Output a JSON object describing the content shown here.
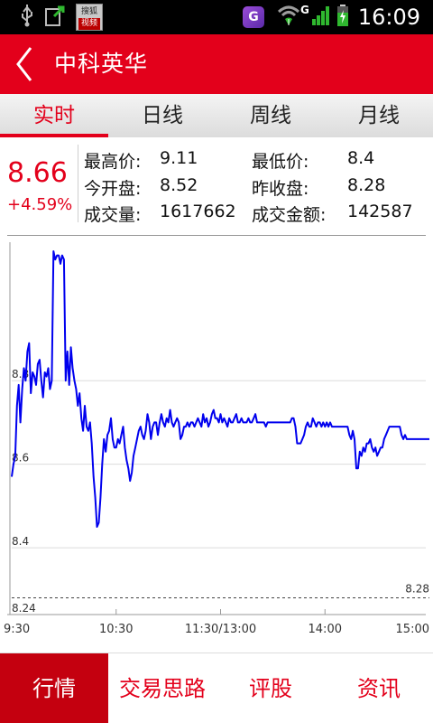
{
  "status_bar": {
    "time": "16:09",
    "network": "G",
    "badge_top": "搜狐",
    "badge_bottom": "视频",
    "app_icon_letter": "G"
  },
  "header": {
    "title": "中科英华"
  },
  "tabs": [
    {
      "label": "实时",
      "active": true
    },
    {
      "label": "日线",
      "active": false
    },
    {
      "label": "周线",
      "active": false
    },
    {
      "label": "月线",
      "active": false
    }
  ],
  "quote": {
    "price": "8.66",
    "change_pct": "+4.59%",
    "high_label": "最高价:",
    "high_value": "9.11",
    "low_label": "最低价:",
    "low_value": "8.4",
    "open_label": "今开盘:",
    "open_value": "8.52",
    "prev_close_label": "昨收盘:",
    "prev_close_value": "8.28",
    "volume_label": "成交量:",
    "volume_value": "1617662",
    "amount_label": "成交金额:",
    "amount_value": "142587"
  },
  "bottom_tabs": [
    {
      "label": "行情",
      "active": true
    },
    {
      "label": "交易思路",
      "active": false
    },
    {
      "label": "评股",
      "active": false
    },
    {
      "label": "资讯",
      "active": false
    }
  ],
  "colors": {
    "brand_red": "#e3001b",
    "line_blue": "#0000ee",
    "grid": "#dcdcdc"
  },
  "chart_data": {
    "type": "line",
    "y_tick_labels": [
      "8.8",
      "8.6",
      "8.4",
      "8.24"
    ],
    "y_ticks": [
      8.8,
      8.6,
      8.4,
      8.24
    ],
    "x_tick_labels": [
      "9:30",
      "10:30",
      "11:30/13:00",
      "14:00",
      "15:00"
    ],
    "x_ticks": [
      0,
      60,
      120,
      180,
      240
    ],
    "ylim": [
      8.24,
      9.11
    ],
    "xlim": [
      0,
      240
    ],
    "prev_close": 8.28,
    "prev_close_label": "8.28",
    "grid": true,
    "series": [
      {
        "color": "#0000ee",
        "points": [
          [
            0,
            8.57
          ],
          [
            1,
            8.6
          ],
          [
            2,
            8.62
          ],
          [
            3,
            8.74
          ],
          [
            4,
            8.79
          ],
          [
            5,
            8.7
          ],
          [
            6,
            8.78
          ],
          [
            7,
            8.83
          ],
          [
            8,
            8.8
          ],
          [
            9,
            8.87
          ],
          [
            10,
            8.89
          ],
          [
            11,
            8.77
          ],
          [
            12,
            8.82
          ],
          [
            13,
            8.81
          ],
          [
            14,
            8.79
          ],
          [
            15,
            8.84
          ],
          [
            16,
            8.85
          ],
          [
            17,
            8.8
          ],
          [
            18,
            8.76
          ],
          [
            19,
            8.82
          ],
          [
            20,
            8.81
          ],
          [
            21,
            8.83
          ],
          [
            22,
            8.78
          ],
          [
            23,
            8.8
          ],
          [
            24,
            9.11
          ],
          [
            25,
            9.09
          ],
          [
            26,
            9.1
          ],
          [
            27,
            9.1
          ],
          [
            28,
            9.08
          ],
          [
            29,
            9.1
          ],
          [
            30,
            9.09
          ],
          [
            31,
            8.8
          ],
          [
            32,
            8.87
          ],
          [
            33,
            8.79
          ],
          [
            34,
            8.88
          ],
          [
            35,
            8.83
          ],
          [
            36,
            8.8
          ],
          [
            37,
            8.78
          ],
          [
            38,
            8.74
          ],
          [
            39,
            8.77
          ],
          [
            40,
            8.71
          ],
          [
            41,
            8.68
          ],
          [
            42,
            8.74
          ],
          [
            43,
            8.69
          ],
          [
            44,
            8.68
          ],
          [
            45,
            8.7
          ],
          [
            46,
            8.65
          ],
          [
            47,
            8.57
          ],
          [
            48,
            8.52
          ],
          [
            49,
            8.45
          ],
          [
            50,
            8.46
          ],
          [
            51,
            8.52
          ],
          [
            52,
            8.6
          ],
          [
            53,
            8.66
          ],
          [
            54,
            8.63
          ],
          [
            55,
            8.67
          ],
          [
            56,
            8.68
          ],
          [
            57,
            8.71
          ],
          [
            58,
            8.66
          ],
          [
            59,
            8.64
          ],
          [
            60,
            8.64
          ],
          [
            61,
            8.66
          ],
          [
            62,
            8.65
          ],
          [
            63,
            8.67
          ],
          [
            64,
            8.69
          ],
          [
            65,
            8.64
          ],
          [
            66,
            8.61
          ],
          [
            67,
            8.59
          ],
          [
            68,
            8.56
          ],
          [
            69,
            8.58
          ],
          [
            70,
            8.62
          ],
          [
            71,
            8.64
          ],
          [
            72,
            8.66
          ],
          [
            73,
            8.68
          ],
          [
            74,
            8.69
          ],
          [
            75,
            8.67
          ],
          [
            76,
            8.66
          ],
          [
            77,
            8.68
          ],
          [
            78,
            8.72
          ],
          [
            79,
            8.7
          ],
          [
            80,
            8.66
          ],
          [
            81,
            8.69
          ],
          [
            82,
            8.7
          ],
          [
            83,
            8.7
          ],
          [
            84,
            8.67
          ],
          [
            85,
            8.7
          ],
          [
            86,
            8.72
          ],
          [
            87,
            8.7
          ],
          [
            88,
            8.69
          ],
          [
            89,
            8.71
          ],
          [
            90,
            8.7
          ],
          [
            91,
            8.73
          ],
          [
            92,
            8.7
          ],
          [
            93,
            8.69
          ],
          [
            94,
            8.7
          ],
          [
            95,
            8.71
          ],
          [
            96,
            8.7
          ],
          [
            97,
            8.66
          ],
          [
            98,
            8.67
          ],
          [
            99,
            8.69
          ],
          [
            100,
            8.69
          ],
          [
            101,
            8.7
          ],
          [
            102,
            8.69
          ],
          [
            103,
            8.7
          ],
          [
            104,
            8.7
          ],
          [
            105,
            8.69
          ],
          [
            106,
            8.7
          ],
          [
            107,
            8.71
          ],
          [
            108,
            8.7
          ],
          [
            109,
            8.69
          ],
          [
            110,
            8.72
          ],
          [
            111,
            8.7
          ],
          [
            112,
            8.71
          ],
          [
            113,
            8.69
          ],
          [
            114,
            8.7
          ],
          [
            115,
            8.72
          ],
          [
            116,
            8.73
          ],
          [
            117,
            8.71
          ],
          [
            118,
            8.71
          ],
          [
            119,
            8.7
          ],
          [
            120,
            8.72
          ],
          [
            121,
            8.7
          ],
          [
            122,
            8.71
          ],
          [
            123,
            8.7
          ],
          [
            124,
            8.69
          ],
          [
            125,
            8.71
          ],
          [
            126,
            8.7
          ],
          [
            127,
            8.7
          ],
          [
            128,
            8.71
          ],
          [
            129,
            8.72
          ],
          [
            130,
            8.7
          ],
          [
            131,
            8.7
          ],
          [
            132,
            8.71
          ],
          [
            133,
            8.7
          ],
          [
            134,
            8.7
          ],
          [
            135,
            8.7
          ],
          [
            136,
            8.71
          ],
          [
            137,
            8.7
          ],
          [
            138,
            8.7
          ],
          [
            139,
            8.71
          ],
          [
            140,
            8.72
          ],
          [
            141,
            8.7
          ],
          [
            142,
            8.7
          ],
          [
            143,
            8.7
          ],
          [
            144,
            8.7
          ],
          [
            145,
            8.7
          ],
          [
            146,
            8.69
          ],
          [
            147,
            8.7
          ],
          [
            148,
            8.7
          ],
          [
            149,
            8.7
          ],
          [
            150,
            8.7
          ],
          [
            151,
            8.7
          ],
          [
            152,
            8.7
          ],
          [
            153,
            8.7
          ],
          [
            154,
            8.7
          ],
          [
            155,
            8.7
          ],
          [
            156,
            8.7
          ],
          [
            157,
            8.7
          ],
          [
            158,
            8.7
          ],
          [
            159,
            8.7
          ],
          [
            160,
            8.7
          ],
          [
            161,
            8.71
          ],
          [
            162,
            8.71
          ],
          [
            163,
            8.69
          ],
          [
            164,
            8.65
          ],
          [
            165,
            8.65
          ],
          [
            166,
            8.65
          ],
          [
            167,
            8.66
          ],
          [
            168,
            8.67
          ],
          [
            169,
            8.69
          ],
          [
            170,
            8.7
          ],
          [
            171,
            8.69
          ],
          [
            172,
            8.69
          ],
          [
            173,
            8.71
          ],
          [
            174,
            8.7
          ],
          [
            175,
            8.69
          ],
          [
            176,
            8.7
          ],
          [
            177,
            8.7
          ],
          [
            178,
            8.69
          ],
          [
            179,
            8.7
          ],
          [
            180,
            8.69
          ],
          [
            181,
            8.7
          ],
          [
            182,
            8.69
          ],
          [
            183,
            8.7
          ],
          [
            184,
            8.69
          ],
          [
            185,
            8.69
          ],
          [
            186,
            8.69
          ],
          [
            187,
            8.69
          ],
          [
            188,
            8.69
          ],
          [
            189,
            8.69
          ],
          [
            190,
            8.69
          ],
          [
            191,
            8.69
          ],
          [
            192,
            8.69
          ],
          [
            193,
            8.69
          ],
          [
            194,
            8.67
          ],
          [
            195,
            8.66
          ],
          [
            196,
            8.68
          ],
          [
            197,
            8.66
          ],
          [
            198,
            8.59
          ],
          [
            199,
            8.59
          ],
          [
            200,
            8.63
          ],
          [
            201,
            8.62
          ],
          [
            202,
            8.64
          ],
          [
            203,
            8.63
          ],
          [
            204,
            8.65
          ],
          [
            205,
            8.65
          ],
          [
            206,
            8.66
          ],
          [
            207,
            8.64
          ],
          [
            208,
            8.63
          ],
          [
            209,
            8.64
          ],
          [
            210,
            8.62
          ],
          [
            211,
            8.63
          ],
          [
            212,
            8.64
          ],
          [
            213,
            8.64
          ],
          [
            214,
            8.66
          ],
          [
            215,
            8.67
          ],
          [
            216,
            8.68
          ],
          [
            217,
            8.69
          ],
          [
            218,
            8.69
          ],
          [
            219,
            8.69
          ],
          [
            220,
            8.69
          ],
          [
            221,
            8.69
          ],
          [
            222,
            8.69
          ],
          [
            223,
            8.69
          ],
          [
            224,
            8.67
          ],
          [
            225,
            8.66
          ],
          [
            226,
            8.67
          ],
          [
            227,
            8.66
          ],
          [
            228,
            8.66
          ],
          [
            229,
            8.66
          ],
          [
            230,
            8.66
          ],
          [
            231,
            8.66
          ],
          [
            232,
            8.66
          ],
          [
            233,
            8.66
          ],
          [
            234,
            8.66
          ],
          [
            235,
            8.66
          ],
          [
            236,
            8.66
          ],
          [
            237,
            8.66
          ],
          [
            238,
            8.66
          ],
          [
            239,
            8.66
          ],
          [
            240,
            8.66
          ]
        ]
      }
    ]
  }
}
